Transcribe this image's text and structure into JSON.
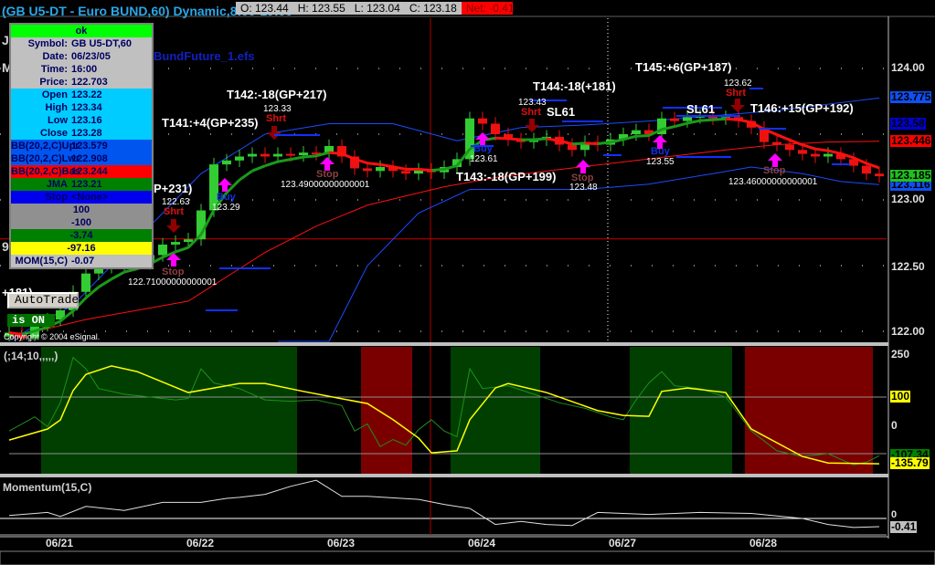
{
  "header": {
    "title": "(GB U5-DT - Euro BUND,60) Dynamic,8:00-19:00",
    "open": "O: 123.44",
    "high": "H: 123.55",
    "low": "L: 123.04",
    "close": "C: 123.18",
    "net": "Net: -0.41"
  },
  "data_window": [
    {
      "label": "",
      "value": "ok",
      "bg": "#00ff00"
    },
    {
      "label": "Symbol:",
      "value": "GB U5-DT,60",
      "bg": "#c0c0c0"
    },
    {
      "label": "Date:",
      "value": "06/23/05",
      "bg": "#c0c0c0"
    },
    {
      "label": "Time:",
      "value": "16:00",
      "bg": "#c0c0c0"
    },
    {
      "label": "Price:",
      "value": "122.703",
      "bg": "#c0c0c0"
    },
    {
      "label": "Open",
      "value": "123.22",
      "bg": "#00ccff"
    },
    {
      "label": "High",
      "value": "123.34",
      "bg": "#00ccff"
    },
    {
      "label": "Low",
      "value": "123.16",
      "bg": "#00ccff"
    },
    {
      "label": "Close",
      "value": "123.28",
      "bg": "#00ccff"
    },
    {
      "label": "BB(20,2,C)Upr",
      "value": "123.579",
      "bg": "#0055ee"
    },
    {
      "label": "BB(20,2,C)Lwr",
      "value": "122.908",
      "bg": "#0055ee"
    },
    {
      "label": "BB(20,2,C)Bas",
      "value": "123.244",
      "bg": "#ff0000"
    },
    {
      "label": "JMA",
      "value": "123.21",
      "bg": "#008000"
    },
    {
      "label": "Stop",
      "value": "<None>",
      "bg": "#0000ee"
    },
    {
      "label": "",
      "value": "100",
      "bg": "#909090"
    },
    {
      "label": "",
      "value": "-100",
      "bg": "#909090"
    },
    {
      "label": "",
      "value": "-3.74",
      "bg": "#008000"
    },
    {
      "label": "",
      "value": "-97.16",
      "bg": "#ffff00"
    },
    {
      "label": "MOM(15,C)",
      "value": "-0.07",
      "bg": "#c0c0c0"
    }
  ],
  "left_labels": {
    "j": "J",
    "m": "M",
    "nine": "9",
    "t140_partial": "+181)",
    "efs": "BundFuture_1.efs",
    "autotrade": "AutoTrade",
    "is_on": "is ON",
    "copyright": "Copyright © 2004 eSignal.",
    "t_partial": "P+231)"
  },
  "annotations": {
    "t141": "T141:+4(GP+235)",
    "t142": "T142:-18(GP+217)",
    "t143": "T143:-18(GP+199)",
    "t144": "T144:-18(+181)",
    "t145": "T145:+6(GP+187)",
    "t146": "T146:+15(GP+192)",
    "p1": "122.63",
    "shrt1": "Shrt",
    "stop1": "Stop",
    "stopv1": "122.71000000000001",
    "buy1": "Buy",
    "buyv1": "123.29",
    "p2": "123.33",
    "shrt2": "Shrt",
    "stop2": "Stop",
    "stopv2": "123.49000000000001",
    "buy2": "Buy",
    "buyv2": "123.61",
    "p3": "123.43",
    "shrt3": "Shrt",
    "sl1": "SL61",
    "stop3": "Stop",
    "stopv3": "123.48",
    "buy3": "Buy",
    "buyv3": "123.55",
    "sl2": "SL61",
    "p4": "123.62",
    "shrt4": "Shrt",
    "stop4": "Stop",
    "stopv4": "123.46000000000001"
  },
  "price_axis": {
    "ticks": [
      "124.00",
      "123.00",
      "122.50",
      "122.00"
    ],
    "tags": [
      {
        "text": "123.775",
        "bg": "#1050f0",
        "fg": "#000"
      },
      {
        "text": "123.58",
        "bg": "#0000d0",
        "fg": "#000"
      },
      {
        "text": "123.446",
        "bg": "#ff0000",
        "fg": "#000"
      },
      {
        "text": "123.116",
        "bg": "#1050f0",
        "fg": "#000"
      },
      {
        "text": "123.185",
        "bg": "#20c020",
        "fg": "#000"
      }
    ]
  },
  "indicator": {
    "label": "(;14;10,,,,,)",
    "ticks": [
      "250",
      "100",
      "0"
    ],
    "tags": [
      {
        "text": "-107.34",
        "bg": "#008000"
      },
      {
        "text": "-135.79",
        "bg": "#ffff00"
      }
    ],
    "upper_level_tag": "100"
  },
  "momentum": {
    "label": "Momentum(15,C)",
    "zero": "0",
    "value": "-0.41"
  },
  "dates": [
    "06/21",
    "06/22",
    "06/23",
    "06/24",
    "06/27",
    "06/28"
  ],
  "chart_data": {
    "type": "candlestick",
    "title": "GB U5-DT - Euro BUND,60",
    "ylim": [
      121.6,
      124.3
    ],
    "closes": [
      121.99,
      121.95,
      122.05,
      122.09,
      122.16,
      122.3,
      122.44,
      122.49,
      122.51,
      122.55,
      122.52,
      122.58,
      122.66,
      122.68,
      122.7,
      122.92,
      123.27,
      123.3,
      123.33,
      123.35,
      123.33,
      123.35,
      123.34,
      123.36,
      123.35,
      123.41,
      123.33,
      123.24,
      123.22,
      123.25,
      123.22,
      123.2,
      123.23,
      123.21,
      123.25,
      123.31,
      123.62,
      123.58,
      123.5,
      123.46,
      123.44,
      123.46,
      123.48,
      123.42,
      123.38,
      123.44,
      123.42,
      123.46,
      123.5,
      123.53,
      123.5,
      123.62,
      123.6,
      123.63,
      123.64,
      123.62,
      123.63,
      123.6,
      123.55,
      123.44,
      123.42,
      123.38,
      123.35,
      123.33,
      123.35,
      123.31,
      123.26,
      123.2,
      123.18
    ],
    "bb_upper": [
      [
        0,
        121.93
      ],
      [
        5,
        122.2
      ],
      [
        10,
        122.7
      ],
      [
        15,
        123.2
      ],
      [
        20,
        123.5
      ],
      [
        25,
        123.58
      ],
      [
        30,
        123.58
      ],
      [
        35,
        123.45
      ],
      [
        40,
        123.55
      ],
      [
        45,
        123.57
      ],
      [
        50,
        123.6
      ],
      [
        55,
        123.64
      ],
      [
        60,
        123.68
      ],
      [
        65,
        123.74
      ],
      [
        68,
        123.775
      ]
    ],
    "bb_lower": [
      [
        21,
        121.25
      ],
      [
        25,
        121.9
      ],
      [
        28,
        122.5
      ],
      [
        32,
        122.9
      ],
      [
        36,
        123.08
      ],
      [
        40,
        123.08
      ],
      [
        45,
        123.08
      ],
      [
        50,
        123.12
      ],
      [
        55,
        123.2
      ],
      [
        58,
        123.25
      ],
      [
        62,
        123.2
      ],
      [
        65,
        123.14
      ],
      [
        68,
        123.116
      ]
    ],
    "bb_basis": [
      [
        0,
        121.95
      ],
      [
        6,
        122.09
      ],
      [
        14,
        122.23
      ],
      [
        20,
        122.6
      ],
      [
        24,
        122.8
      ],
      [
        28,
        122.96
      ],
      [
        34,
        123.1
      ],
      [
        38,
        123.17
      ],
      [
        42,
        123.22
      ],
      [
        49,
        123.3
      ],
      [
        56,
        123.38
      ],
      [
        60,
        123.42
      ],
      [
        64,
        123.44
      ],
      [
        68,
        123.446
      ]
    ],
    "cursor_price": 122.703,
    "indicator_signal": [
      [
        0,
        -52
      ],
      [
        3,
        -13
      ],
      [
        4,
        19
      ],
      [
        5,
        123
      ],
      [
        6,
        180
      ],
      [
        8,
        210
      ],
      [
        10,
        190
      ],
      [
        14,
        116
      ],
      [
        18,
        148
      ],
      [
        20,
        148
      ],
      [
        23,
        120
      ],
      [
        26,
        94
      ],
      [
        28,
        77
      ],
      [
        30,
        20
      ],
      [
        32,
        -45
      ],
      [
        33,
        -97
      ],
      [
        35,
        -90
      ],
      [
        36,
        20
      ],
      [
        38,
        132
      ],
      [
        39,
        148
      ],
      [
        42,
        116
      ],
      [
        46,
        52
      ],
      [
        48,
        35
      ],
      [
        50,
        32
      ],
      [
        51,
        120
      ],
      [
        53,
        132
      ],
      [
        56,
        116
      ],
      [
        58,
        -13
      ],
      [
        62,
        -110
      ],
      [
        64,
        -133
      ],
      [
        68,
        -135.79
      ]
    ],
    "indicator_raw": [
      [
        0,
        -20
      ],
      [
        2,
        30
      ],
      [
        3,
        -5
      ],
      [
        4,
        80
      ],
      [
        5,
        240
      ],
      [
        6,
        200
      ],
      [
        7,
        130
      ],
      [
        9,
        110
      ],
      [
        11,
        100
      ],
      [
        13,
        90
      ],
      [
        14,
        95
      ],
      [
        15,
        200
      ],
      [
        16,
        150
      ],
      [
        18,
        130
      ],
      [
        20,
        90
      ],
      [
        22,
        85
      ],
      [
        24,
        90
      ],
      [
        26,
        70
      ],
      [
        27,
        -20
      ],
      [
        28,
        5
      ],
      [
        29,
        -75
      ],
      [
        30,
        -50
      ],
      [
        31,
        -70
      ],
      [
        32,
        -15
      ],
      [
        33,
        20
      ],
      [
        34,
        -20
      ],
      [
        35,
        -40
      ],
      [
        36,
        200
      ],
      [
        37,
        130
      ],
      [
        39,
        140
      ],
      [
        41,
        110
      ],
      [
        43,
        80
      ],
      [
        45,
        60
      ],
      [
        47,
        30
      ],
      [
        48,
        20
      ],
      [
        49,
        90
      ],
      [
        50,
        150
      ],
      [
        51,
        190
      ],
      [
        52,
        140
      ],
      [
        54,
        130
      ],
      [
        56,
        100
      ],
      [
        58,
        -20
      ],
      [
        60,
        -90
      ],
      [
        62,
        -110
      ],
      [
        64,
        -100
      ],
      [
        66,
        -140
      ],
      [
        67,
        -130
      ],
      [
        68,
        -107.34
      ]
    ],
    "indicator_levels": [
      100,
      -100
    ],
    "zones": [
      {
        "from": 3,
        "to": 23,
        "state": "long"
      },
      {
        "from": 28,
        "to": 32,
        "state": "short"
      },
      {
        "from": 35,
        "to": 42,
        "state": "long"
      },
      {
        "from": 49,
        "to": 57,
        "state": "long"
      },
      {
        "from": 58,
        "to": 68,
        "state": "short"
      }
    ],
    "momentum": [
      [
        0,
        0.15
      ],
      [
        3,
        0.3
      ],
      [
        4,
        0.1
      ],
      [
        6,
        0.6
      ],
      [
        9,
        0.4
      ],
      [
        12,
        0.8
      ],
      [
        15,
        0.8
      ],
      [
        17,
        1.0
      ],
      [
        18,
        1.05
      ],
      [
        20,
        1.2
      ],
      [
        22,
        1.6
      ],
      [
        24,
        1.9
      ],
      [
        26,
        1.1
      ],
      [
        28,
        1.1
      ],
      [
        32,
        0.95
      ],
      [
        34,
        0.7
      ],
      [
        36,
        0.5
      ],
      [
        38,
        -0.3
      ],
      [
        40,
        -0.15
      ],
      [
        42,
        -0.3
      ],
      [
        44,
        -0.35
      ],
      [
        46,
        0.3
      ],
      [
        50,
        0.2
      ],
      [
        54,
        0.3
      ],
      [
        58,
        0.25
      ],
      [
        62,
        0.0
      ],
      [
        64,
        -0.3
      ],
      [
        66,
        -0.45
      ],
      [
        68,
        -0.41
      ]
    ],
    "colors": {
      "up": "#33cc33",
      "down": "#ee1111",
      "bb": "#1a4cff",
      "basis": "#ff1010",
      "long_zone": "#003f00",
      "short_zone": "#7a0000",
      "signal": "#ffff00",
      "raw": "#1f8f1f"
    }
  }
}
